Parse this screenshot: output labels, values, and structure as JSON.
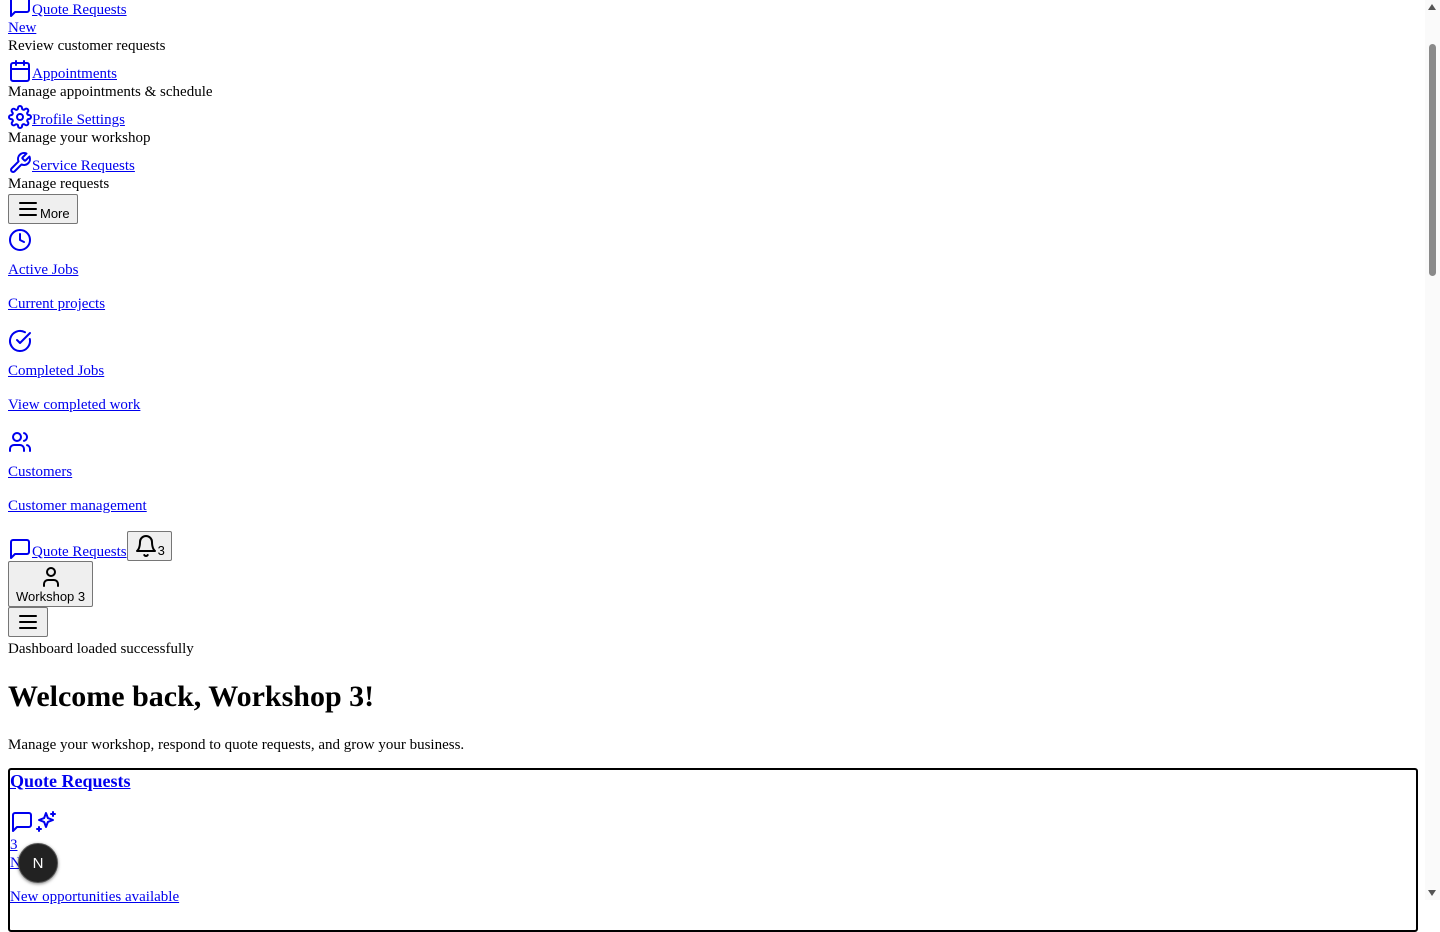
{
  "nav": {
    "quote_requests_label": "Quote Requests",
    "new_label": "New",
    "quote_requests_desc": "Review customer requests",
    "appointments_label": "Appointments",
    "appointments_desc": "Manage appointments & schedule",
    "profile_settings_label": "Profile Settings",
    "profile_settings_desc": "Manage your workshop",
    "service_requests_label": "Service Requests",
    "service_requests_desc": "Manage requests",
    "more_label": "More"
  },
  "more_menu": {
    "items": [
      {
        "icon": "clock-icon",
        "label": "Active Jobs",
        "desc": "Current projects"
      },
      {
        "icon": "check-circle-icon",
        "label": "Completed Jobs",
        "desc": "View completed work"
      },
      {
        "icon": "users-icon",
        "label": "Customers",
        "desc": "Customer management"
      }
    ]
  },
  "header": {
    "quote_requests_label": "Quote Requests",
    "notification_count": "3",
    "user_label": "Workshop 3"
  },
  "status_message": "Dashboard loaded successfully",
  "welcome": {
    "title": "Welcome back, Workshop 3!",
    "subtitle": "Manage your workshop, respond to quote requests, and grow your business."
  },
  "card": {
    "title": "Quote Requests",
    "count": "3",
    "new_label": "New",
    "footer": "New opportunities available"
  },
  "dev_badge": "N"
}
